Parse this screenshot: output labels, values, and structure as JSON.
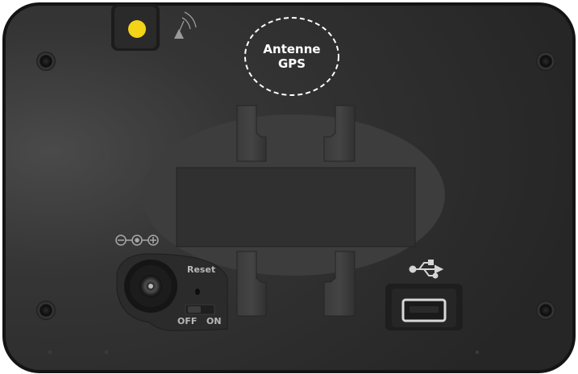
{
  "gps_antenna": {
    "line1": "Antenne",
    "line2": "GPS"
  },
  "controls": {
    "reset_label": "Reset",
    "off_label": "OFF",
    "on_label": "ON"
  },
  "icons": {
    "power_polarity": "dc-polarity-icon",
    "usb": "usb-icon",
    "gps_signal": "gps-signal-icon"
  },
  "colors": {
    "indicator": "#f5d316",
    "body": "#2e2e2e",
    "edge": "#1a1a1a",
    "label": "#b8b8b8"
  }
}
